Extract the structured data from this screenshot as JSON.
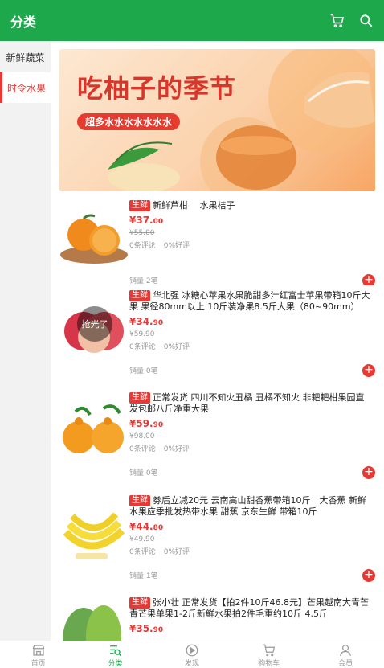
{
  "header": {
    "title": "分类",
    "cart_icon": "cart-icon",
    "search_icon": "search-icon"
  },
  "sidebar": {
    "items": [
      {
        "label": "新鲜蔬菜"
      },
      {
        "label": "时令水果"
      }
    ]
  },
  "banner": {
    "headline": "吃柚子的季节",
    "pill": "超多水水水水水水水"
  },
  "products": [
    {
      "tag": "生鲜",
      "name": "新鲜芦柑　 水果桔子",
      "price_int": "¥37.",
      "price_dec": "00",
      "old_price": "¥55.00",
      "reviews": "0条评论",
      "rating": "0%好评",
      "sales": "销量 2笔"
    },
    {
      "tag": "生鲜",
      "name": "华北强 冰糖心苹果水果脆甜多汁红富士苹果带箱10斤大果 果径80mm以上 10斤装净果8.5斤大果（80~90mm）",
      "price_int": "¥34.",
      "price_dec": "90",
      "old_price": "¥59.90",
      "reviews": "0条评论",
      "rating": "0%好评",
      "sales": "销量 0笔",
      "sold_out": "抢光了"
    },
    {
      "tag": "生鲜",
      "name": "正常发货 四川不知火丑橘 丑橘不知火  非耙耙柑果园直发包邮八斤净重大果",
      "price_int": "¥59.",
      "price_dec": "90",
      "old_price": "¥98.00",
      "reviews": "0条评论",
      "rating": "0%好评",
      "sales": "销量 0笔"
    },
    {
      "tag": "生鲜",
      "name": "劵后立减20元 云南高山甜香蕉带箱10斤　大香蕉 新鲜水果应季批发热带水果 甜蕉 京东生鲜 带箱10斤",
      "price_int": "¥44.",
      "price_dec": "80",
      "old_price": "¥49.90",
      "reviews": "0条评论",
      "rating": "0%好评",
      "sales": "销量 1笔"
    },
    {
      "tag": "生鲜",
      "name": "张小壮 正常发货【拍2件10斤46.8元】芒果越南大青芒青芒果单果1-2斤新鲜水果拍2件毛重约10斤 4.5斤",
      "price_int": "¥35.",
      "price_dec": "90"
    }
  ],
  "tabbar": [
    {
      "label": "首页",
      "icon": "home-icon"
    },
    {
      "label": "分类",
      "icon": "category-icon"
    },
    {
      "label": "发现",
      "icon": "discover-icon"
    },
    {
      "label": "购物车",
      "icon": "cart-icon"
    },
    {
      "label": "会员",
      "icon": "member-icon"
    }
  ],
  "colors": {
    "brand": "#1ea84c",
    "accent": "#e53935"
  }
}
